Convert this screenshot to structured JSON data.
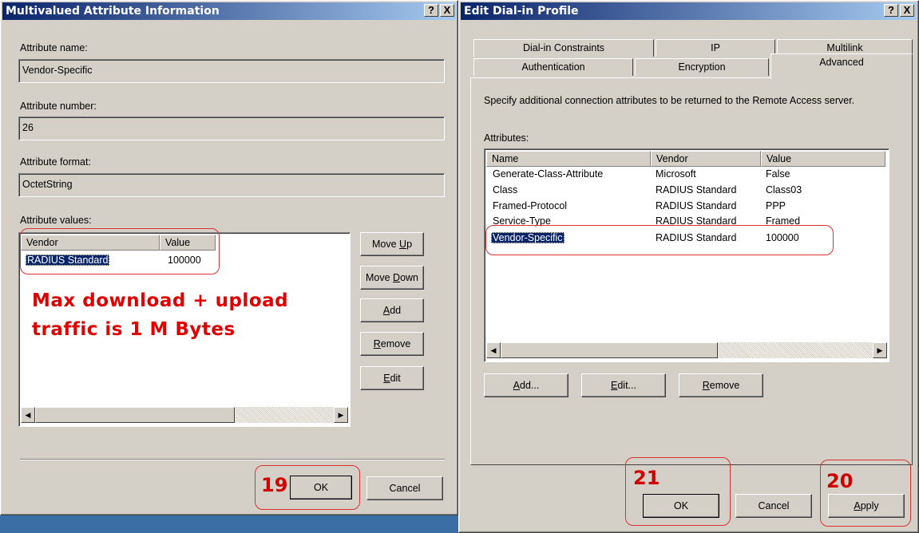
{
  "left": {
    "title": "Multivalued Attribute Information",
    "help": "?",
    "close": "X",
    "name_label": "Attribute name:",
    "name_value": "Vendor-Specific",
    "number_label": "Attribute number:",
    "number_value": "26",
    "format_label": "Attribute format:",
    "format_value": "OctetString",
    "values_label": "Attribute values:",
    "col_vendor": "Vendor",
    "col_value": "Value",
    "row_vendor": "RADIUS Standard",
    "row_value": "100000",
    "move_up": "Move Up",
    "move_down": "Move Down",
    "add": "Add",
    "remove": "Remove",
    "edit": "Edit",
    "ok": "OK",
    "cancel": "Cancel",
    "annotation_line1": "Max download + upload",
    "annotation_line2": "traffic is 1 M Bytes",
    "step_ok": "19"
  },
  "right": {
    "title": "Edit Dial-in Profile",
    "help": "?",
    "close": "X",
    "tabs_back": [
      "Dial-in Constraints",
      "IP",
      "Multilink"
    ],
    "tabs_front": [
      "Authentication",
      "Encryption",
      "Advanced"
    ],
    "description": "Specify additional connection attributes to be returned to the Remote Access server.",
    "attributes_label": "Attributes:",
    "columns": [
      "Name",
      "Vendor",
      "Value"
    ],
    "rows": [
      {
        "name": "Generate-Class-Attribute",
        "vendor": "Microsoft",
        "value": "False"
      },
      {
        "name": "Class",
        "vendor": "RADIUS Standard",
        "value": "Class03"
      },
      {
        "name": "Framed-Protocol",
        "vendor": "RADIUS Standard",
        "value": "PPP"
      },
      {
        "name": "Service-Type",
        "vendor": "RADIUS Standard",
        "value": "Framed"
      },
      {
        "name": "Vendor-Specific",
        "vendor": "RADIUS Standard",
        "value": "100000"
      }
    ],
    "add": "Add...",
    "edit": "Edit...",
    "remove": "Remove",
    "ok": "OK",
    "cancel": "Cancel",
    "apply": "Apply",
    "step_ok": "21",
    "step_apply": "20"
  }
}
